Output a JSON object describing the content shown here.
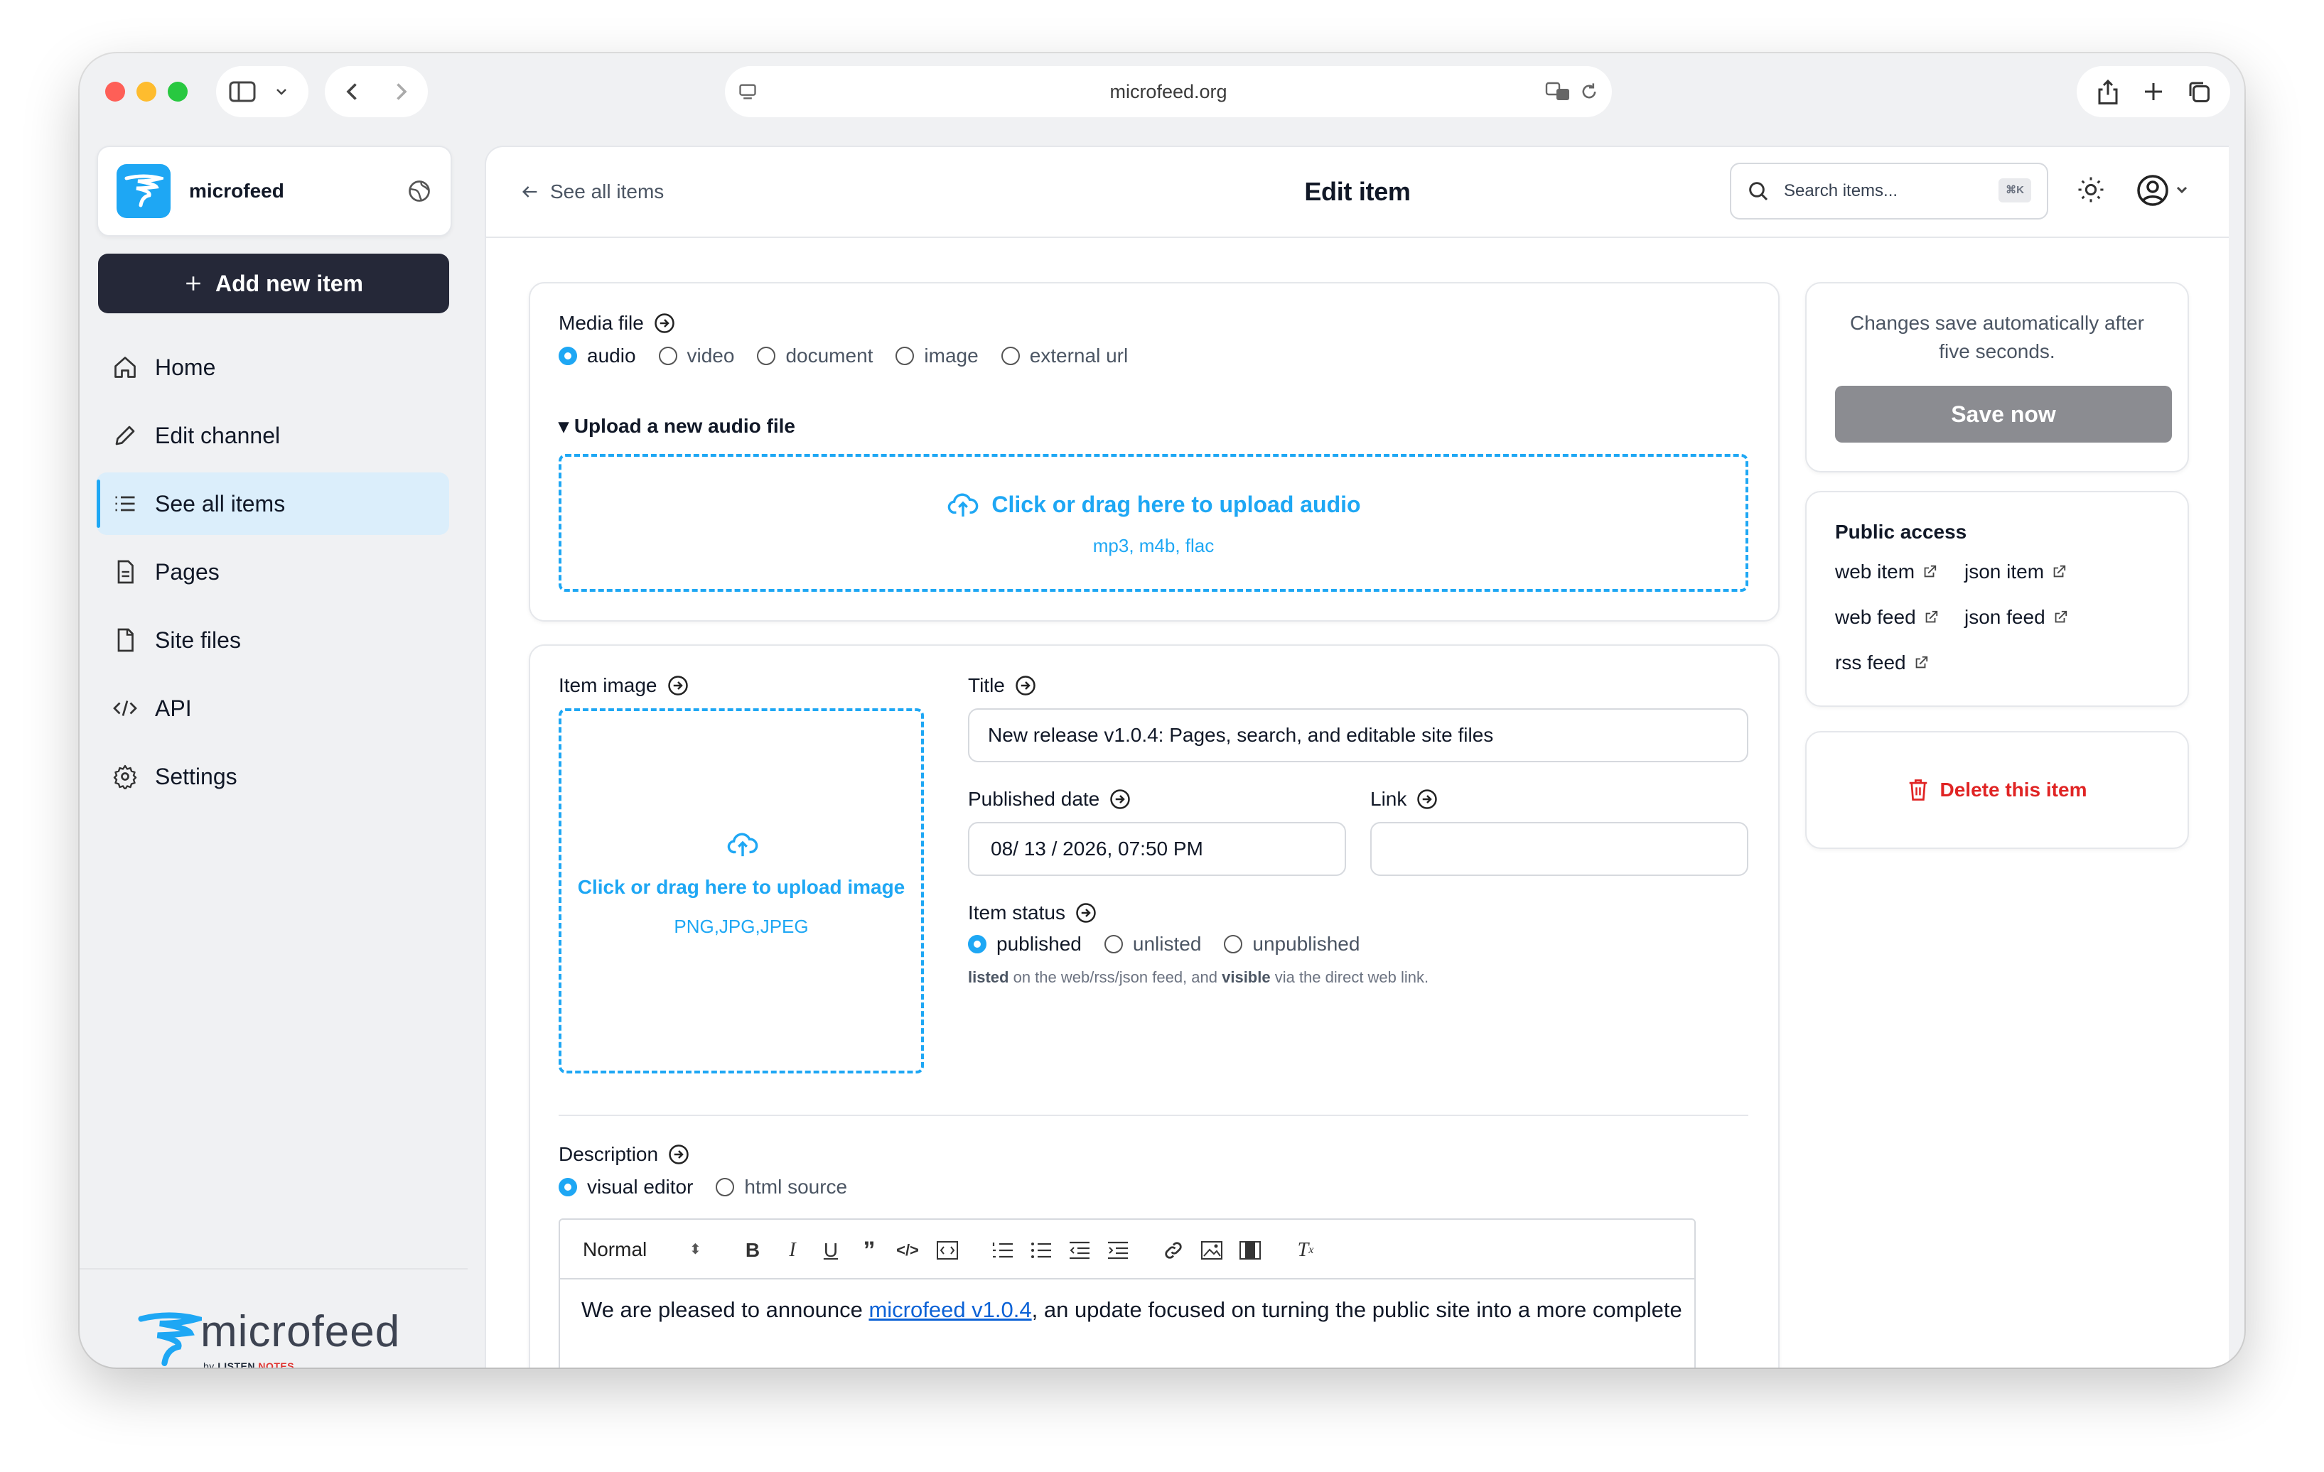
{
  "browser": {
    "url": "microfeed.org"
  },
  "sidebar": {
    "brand": "microfeed",
    "add_button": "Add new item",
    "items": [
      {
        "label": "Home",
        "icon": "home-icon"
      },
      {
        "label": "Edit channel",
        "icon": "pencil-icon"
      },
      {
        "label": "See all items",
        "icon": "list-icon",
        "active": true
      },
      {
        "label": "Pages",
        "icon": "page-icon"
      },
      {
        "label": "Site files",
        "icon": "file-icon"
      },
      {
        "label": "API",
        "icon": "code-icon"
      },
      {
        "label": "Settings",
        "icon": "gear-icon"
      }
    ],
    "footer_logo": "microfeed",
    "footer_by": "by",
    "footer_brand": "LISTEN",
    "footer_brand2": "NOTES"
  },
  "header": {
    "back_link": "See all items",
    "title": "Edit item",
    "search_placeholder": "Search items...",
    "search_shortcut": "⌘K"
  },
  "media": {
    "label": "Media file",
    "options": [
      "audio",
      "video",
      "document",
      "image",
      "external url"
    ],
    "selected": "audio",
    "upload_heading": "▾ Upload a new audio file",
    "dropzone_main": "Click or drag here to upload audio",
    "dropzone_sub": "mp3, m4b, flac"
  },
  "item": {
    "image_label": "Item image",
    "image_drop_main": "Click or drag here to upload image",
    "image_drop_sub": "PNG,JPG,JPEG",
    "title_label": "Title",
    "title_value": "New release v1.0.4: Pages, search, and editable site files",
    "date_label": "Published date",
    "date_value": "08/ 13 / 2026, 07:50 PM",
    "link_label": "Link",
    "link_value": "",
    "status_label": "Item status",
    "status_options": [
      "published",
      "unlisted",
      "unpublished"
    ],
    "status_selected": "published",
    "status_hint_1": "listed",
    "status_hint_2": " on the web/rss/json feed, and ",
    "status_hint_3": "visible",
    "status_hint_4": " via the direct web link."
  },
  "description": {
    "label": "Description",
    "modes": [
      "visual editor",
      "html source"
    ],
    "selected": "visual editor",
    "format_select": "Normal",
    "text_before": "We are pleased to announce ",
    "link_text": "microfeed v1.0.4",
    "text_after": ", an update focused on turning the public site into a more complete"
  },
  "save": {
    "message": "Changes save automatically after five seconds.",
    "button": "Save now"
  },
  "public_access": {
    "title": "Public access",
    "links": [
      "web item",
      "json item",
      "web feed",
      "json feed",
      "rss feed"
    ]
  },
  "delete": {
    "label": "Delete this item"
  },
  "colors": {
    "accent": "#1ea7f4",
    "dark_button": "#252838",
    "danger": "#e02424",
    "save_disabled": "#8b8c91"
  }
}
